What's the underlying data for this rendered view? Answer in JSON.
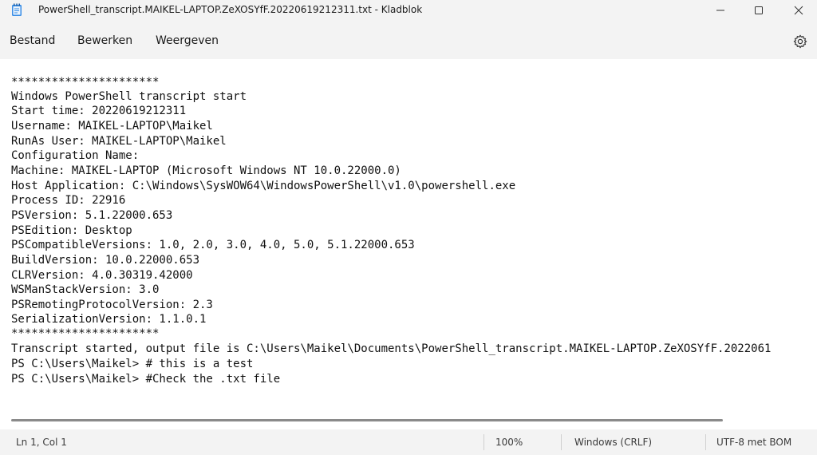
{
  "window": {
    "title": "PowerShell_transcript.MAIKEL-LAPTOP.ZeXOSYfF.20220619212311.txt - Kladblok",
    "app_icon": "notepad-icon",
    "controls": [
      "minimize-icon",
      "maximize-icon",
      "close-icon"
    ]
  },
  "menu": {
    "items": [
      {
        "label": "Bestand"
      },
      {
        "label": "Bewerken"
      },
      {
        "label": "Weergeven"
      }
    ],
    "settings_icon": "gear-icon"
  },
  "editor": {
    "lines": [
      "**********************",
      "Windows PowerShell transcript start",
      "Start time: 20220619212311",
      "Username: MAIKEL-LAPTOP\\Maikel",
      "RunAs User: MAIKEL-LAPTOP\\Maikel",
      "Configuration Name: ",
      "Machine: MAIKEL-LAPTOP (Microsoft Windows NT 10.0.22000.0)",
      "Host Application: C:\\Windows\\SysWOW64\\WindowsPowerShell\\v1.0\\powershell.exe",
      "Process ID: 22916",
      "PSVersion: 5.1.22000.653",
      "PSEdition: Desktop",
      "PSCompatibleVersions: 1.0, 2.0, 3.0, 4.0, 5.0, 5.1.22000.653",
      "BuildVersion: 10.0.22000.653",
      "CLRVersion: 4.0.30319.42000",
      "WSManStackVersion: 3.0",
      "PSRemotingProtocolVersion: 2.3",
      "SerializationVersion: 1.1.0.1",
      "**********************",
      "Transcript started, output file is C:\\Users\\Maikel\\Documents\\PowerShell_transcript.MAIKEL-LAPTOP.ZeXOSYfF.2022061",
      "PS C:\\Users\\Maikel> # this is a test",
      "PS C:\\Users\\Maikel> #Check the .txt file"
    ]
  },
  "status": {
    "position": "Ln 1, Col 1",
    "zoom": "100%",
    "line_ending": "Windows (CRLF)",
    "encoding": "UTF-8 met BOM"
  }
}
